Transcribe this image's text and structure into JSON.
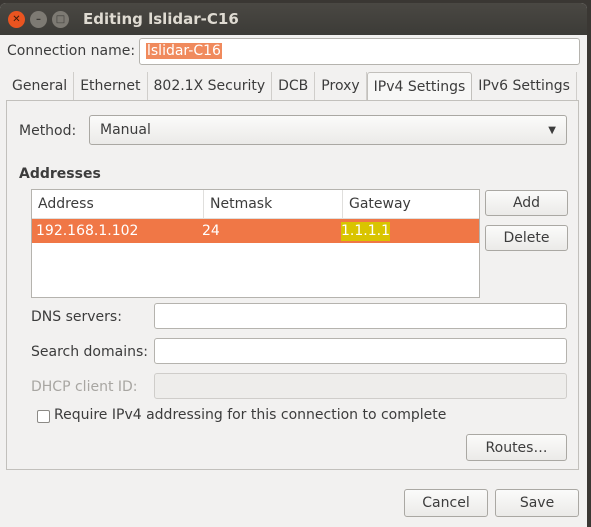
{
  "window": {
    "title": "Editing lslidar-C16"
  },
  "connection": {
    "label": "Connection name:",
    "value": "lslidar-C16"
  },
  "tabs": [
    "General",
    "Ethernet",
    "802.1X Security",
    "DCB",
    "Proxy",
    "IPv4 Settings",
    "IPv6 Settings"
  ],
  "active_tab": "IPv4 Settings",
  "method": {
    "label": "Method:",
    "value": "Manual"
  },
  "addresses": {
    "heading": "Addresses",
    "columns": [
      "Address",
      "Netmask",
      "Gateway"
    ],
    "rows": [
      [
        "192.168.1.102",
        "24",
        "1.1.1.1"
      ]
    ],
    "add": "Add",
    "delete": "Delete"
  },
  "dns": {
    "label": "DNS servers:",
    "value": ""
  },
  "search": {
    "label": "Search domains:",
    "value": ""
  },
  "dhcp": {
    "label": "DHCP client ID:",
    "value": ""
  },
  "require": {
    "label": "Require IPv4 addressing for this connection to complete",
    "checked": false
  },
  "routes": "Routes…",
  "cancel": "Cancel",
  "save": "Save",
  "colors": {
    "accent": "#f07746",
    "highlight": "#d9c400"
  }
}
